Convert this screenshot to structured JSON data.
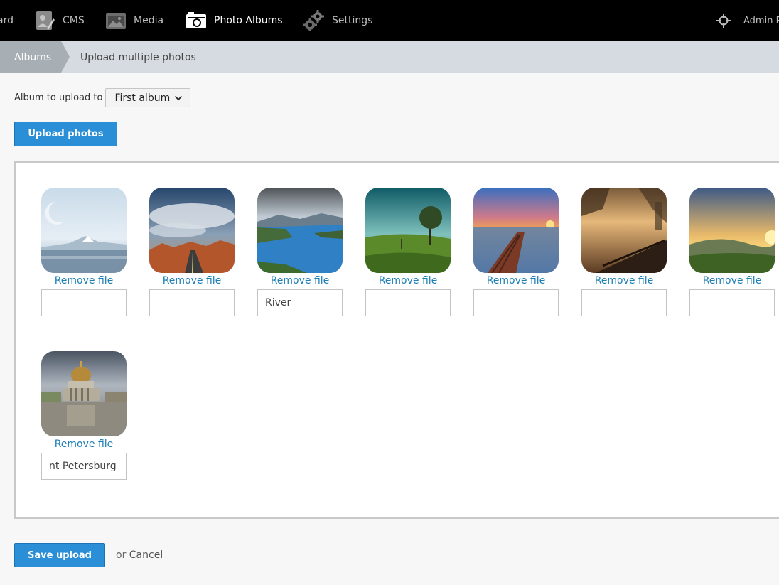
{
  "nav": {
    "dashboard": "ard",
    "cms": "CMS",
    "media": "Media",
    "albums": "Photo Albums",
    "settings": "Settings",
    "admin": "Admin P"
  },
  "breadcrumb": {
    "parent": "Albums",
    "current": "Upload multiple photos"
  },
  "form": {
    "album_label": "Album to upload to",
    "album_selected": "First album",
    "upload_button": "Upload photos",
    "save_button": "Save upload",
    "or_text": "or",
    "cancel_link": "Cancel"
  },
  "photos": [
    {
      "remove_label": "Remove file",
      "title": "",
      "scene": "lake-moon"
    },
    {
      "remove_label": "Remove file",
      "title": "",
      "scene": "desert-road-clouds"
    },
    {
      "remove_label": "Remove file",
      "title": "River",
      "scene": "river-valley"
    },
    {
      "remove_label": "Remove file",
      "title": "",
      "scene": "green-field-tree"
    },
    {
      "remove_label": "Remove file",
      "title": "",
      "scene": "pier-sunset"
    },
    {
      "remove_label": "Remove file",
      "title": "",
      "scene": "railing-sunset"
    },
    {
      "remove_label": "Remove file",
      "title": "",
      "scene": "hills-sunset"
    },
    {
      "remove_label": "Remove file",
      "title": "nt Petersburg",
      "scene": "cathedral"
    }
  ],
  "colors": {
    "topbar": "#000000",
    "accent_button": "#2a8fd6",
    "link": "#1c7fb4",
    "breadcrumb_bar": "#d5dbe0",
    "breadcrumb_active": "#a7afb5"
  }
}
